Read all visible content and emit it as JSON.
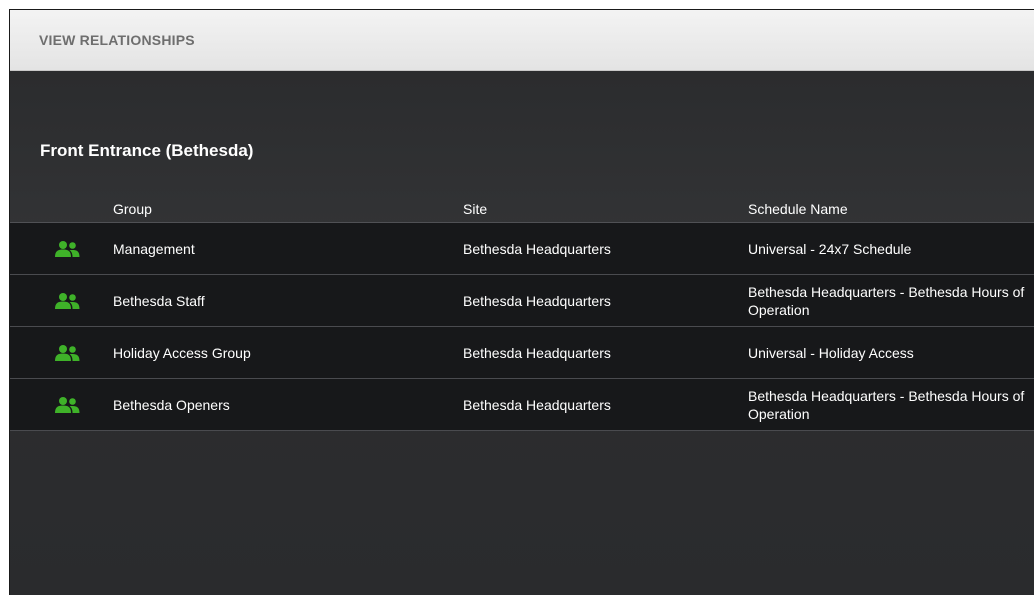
{
  "header": {
    "title": "VIEW RELATIONSHIPS"
  },
  "door": {
    "title": "Front Entrance (Bethesda)"
  },
  "table": {
    "columns": {
      "group": "Group",
      "site": "Site",
      "schedule": "Schedule Name"
    },
    "rows": [
      {
        "icon": "group-users-icon",
        "group": "Management",
        "site": "Bethesda Headquarters",
        "schedule": "Universal - 24x7 Schedule"
      },
      {
        "icon": "group-users-icon",
        "group": "Bethesda Staff",
        "site": "Bethesda Headquarters",
        "schedule": "Bethesda Headquarters - Bethesda Hours of Operation"
      },
      {
        "icon": "group-users-icon",
        "group": "Holiday Access Group",
        "site": "Bethesda Headquarters",
        "schedule": "Universal - Holiday Access"
      },
      {
        "icon": "group-users-icon",
        "group": "Bethesda Openers",
        "site": "Bethesda Headquarters",
        "schedule": "Bethesda Headquarters - Bethesda Hours of Operation"
      }
    ]
  },
  "colors": {
    "icon_green": "#3fb229",
    "header_bg": "#ececec",
    "panel_bg": "#2c2d2f",
    "row_bg": "#17181a"
  }
}
